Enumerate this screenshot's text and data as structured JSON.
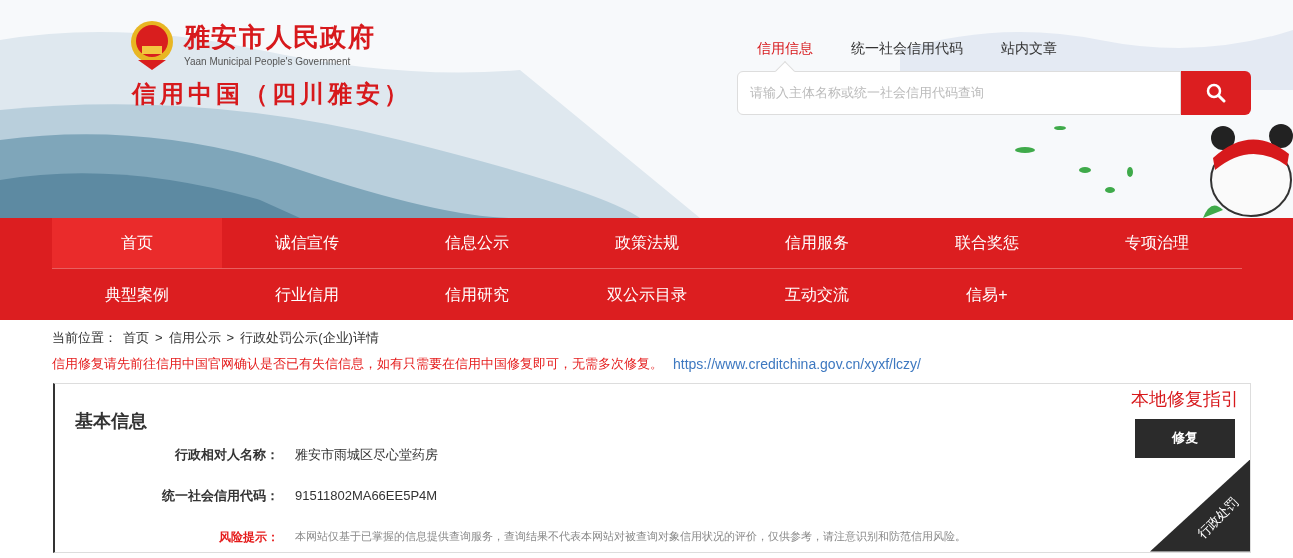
{
  "header": {
    "site_title": "雅安市人民政府",
    "site_subtitle": "Yaan Municipal People's Government",
    "slogan": "信用中国（四川雅安）"
  },
  "search": {
    "tabs": [
      {
        "label": "信用信息",
        "selected": true
      },
      {
        "label": "统一社会信用代码",
        "selected": false
      },
      {
        "label": "站内文章",
        "selected": false
      }
    ],
    "placeholder": "请输入主体名称或统一社会信用代码查询"
  },
  "nav": {
    "rows": [
      [
        {
          "label": "首页",
          "selected": true
        },
        {
          "label": "诚信宣传",
          "selected": false
        },
        {
          "label": "信息公示",
          "selected": false
        },
        {
          "label": "政策法规",
          "selected": false
        },
        {
          "label": "信用服务",
          "selected": false
        },
        {
          "label": "联合奖惩",
          "selected": false
        },
        {
          "label": "专项治理",
          "selected": false
        }
      ],
      [
        {
          "label": "典型案例",
          "selected": false
        },
        {
          "label": "行业信用",
          "selected": false
        },
        {
          "label": "信用研究",
          "selected": false
        },
        {
          "label": "双公示目录",
          "selected": false
        },
        {
          "label": "互动交流",
          "selected": false
        },
        {
          "label": "信易+",
          "selected": false
        }
      ]
    ]
  },
  "breadcrumb": {
    "label": "当前位置：",
    "separator": ">",
    "items": [
      "首页",
      "信用公示",
      "行政处罚公示(企业)详情"
    ]
  },
  "notice": {
    "text": "信用修复请先前往信用中国官网确认是否已有失信信息，如有只需要在信用中国修复即可，无需多次修复。",
    "link": "https://www.creditchina.gov.cn/xyxf/lczy/"
  },
  "card": {
    "title": "基本信息",
    "fields": [
      {
        "kind": "field",
        "label": "行政相对人名称：",
        "value": "雅安市雨城区尽心堂药房"
      },
      {
        "kind": "field",
        "label": "统一社会信用代码：",
        "value": "91511802MA66EE5P4M"
      },
      {
        "kind": "risk",
        "label": "风险提示：",
        "value": "本网站仅基于已掌握的信息提供查询服务，查询结果不代表本网站对被查询对象信用状况的评价，仅供参考，请注意识别和防范信用风险。"
      }
    ],
    "repair_guide": "本地修复指引",
    "repair_button": "修复",
    "ribbon": "行政处罚"
  }
}
